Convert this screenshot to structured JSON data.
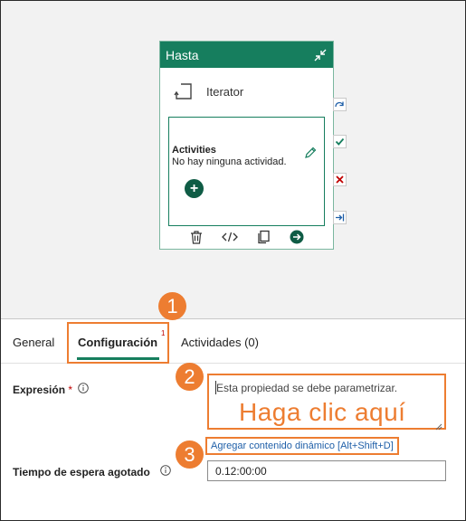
{
  "card": {
    "title": "Hasta",
    "iterator_label": "Iterator",
    "activities_title": "Activities",
    "activities_empty": "No hay ninguna actividad.",
    "add_button_symbol": "+"
  },
  "side_icons": [
    "skip-icon",
    "success-icon",
    "failure-icon",
    "completion-icon"
  ],
  "tabs": [
    {
      "label": "General"
    },
    {
      "label": "Configuración",
      "badge": "1",
      "active": true
    },
    {
      "label": "Actividades (0)"
    }
  ],
  "form": {
    "expression_label": "Expresión",
    "required_marker": "*",
    "expression_placeholder": "Esta propiedad se debe parametrizar.",
    "expression_overlay": "Haga clic aquí",
    "dynamic_content_link": "Agregar contenido dinámico [Alt+Shift+D]",
    "timeout_label": "Tiempo de espera agotado",
    "timeout_value": "0.12:00:00"
  },
  "callouts": [
    "1",
    "2",
    "3"
  ],
  "colors": {
    "brand": "#167e5e",
    "callout": "#ed7d31",
    "link": "#1f5fa8",
    "required": "#c00000"
  }
}
